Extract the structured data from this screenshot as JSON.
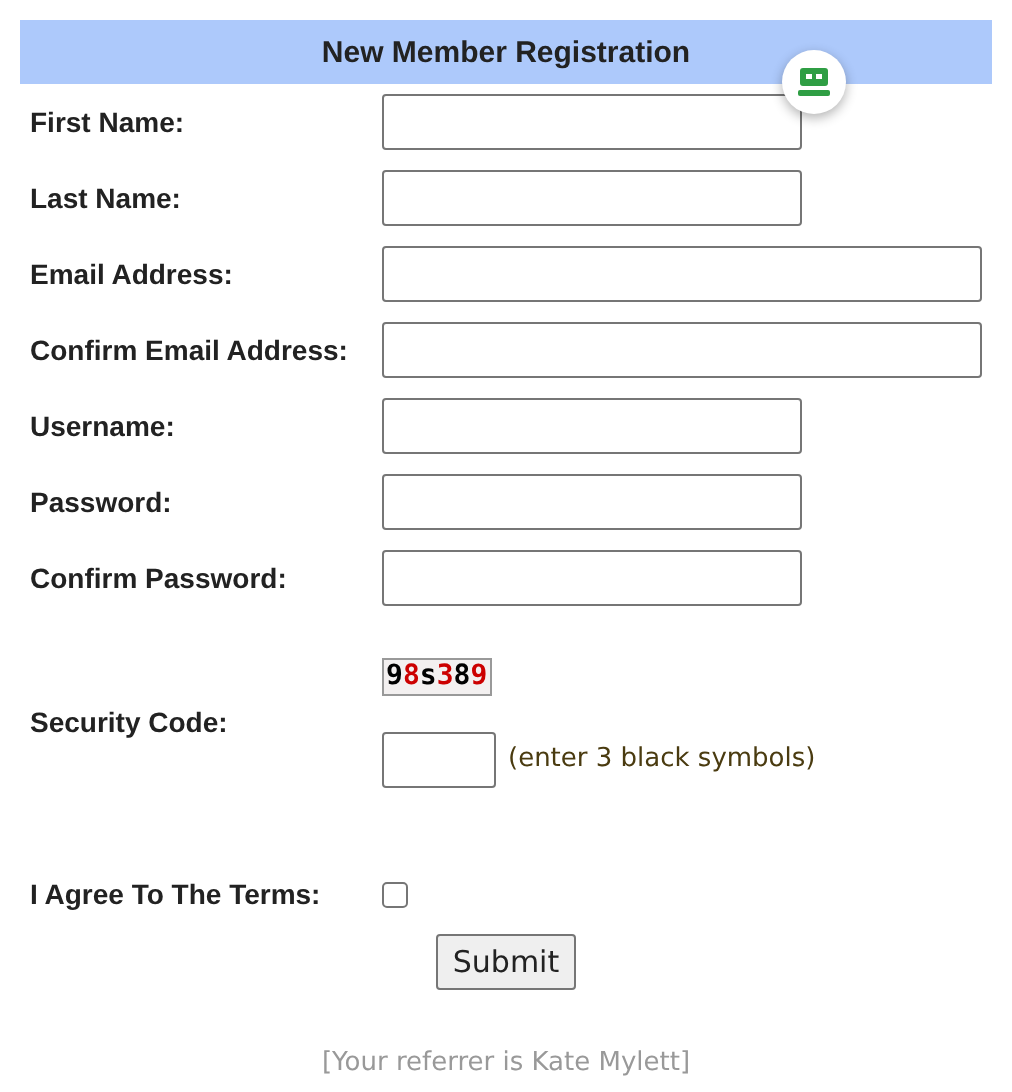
{
  "header": {
    "title": "New Member Registration"
  },
  "fields": [
    {
      "label": "First Name:",
      "kind": "short"
    },
    {
      "label": "Last Name:",
      "kind": "short"
    },
    {
      "label": "Email Address:",
      "kind": "long"
    },
    {
      "label": "Confirm Email Address:",
      "kind": "long"
    },
    {
      "label": "Username:",
      "kind": "short"
    },
    {
      "label": "Password:",
      "kind": "short"
    },
    {
      "label": "Confirm Password:",
      "kind": "short"
    }
  ],
  "security": {
    "label": "Security Code:",
    "captcha": [
      {
        "char": "9",
        "color": "#000000"
      },
      {
        "char": "8",
        "color": "#cc0000"
      },
      {
        "char": "s",
        "color": "#000000"
      },
      {
        "char": "3",
        "color": "#cc0000"
      },
      {
        "char": "8",
        "color": "#000000"
      },
      {
        "char": "9",
        "color": "#cc0000"
      }
    ],
    "hint": "(enter 3 black symbols)"
  },
  "terms": {
    "label": "I Agree To The Terms:",
    "checked": false
  },
  "submit": "Submit",
  "referrer": "[Your referrer is Kate Mylett]"
}
